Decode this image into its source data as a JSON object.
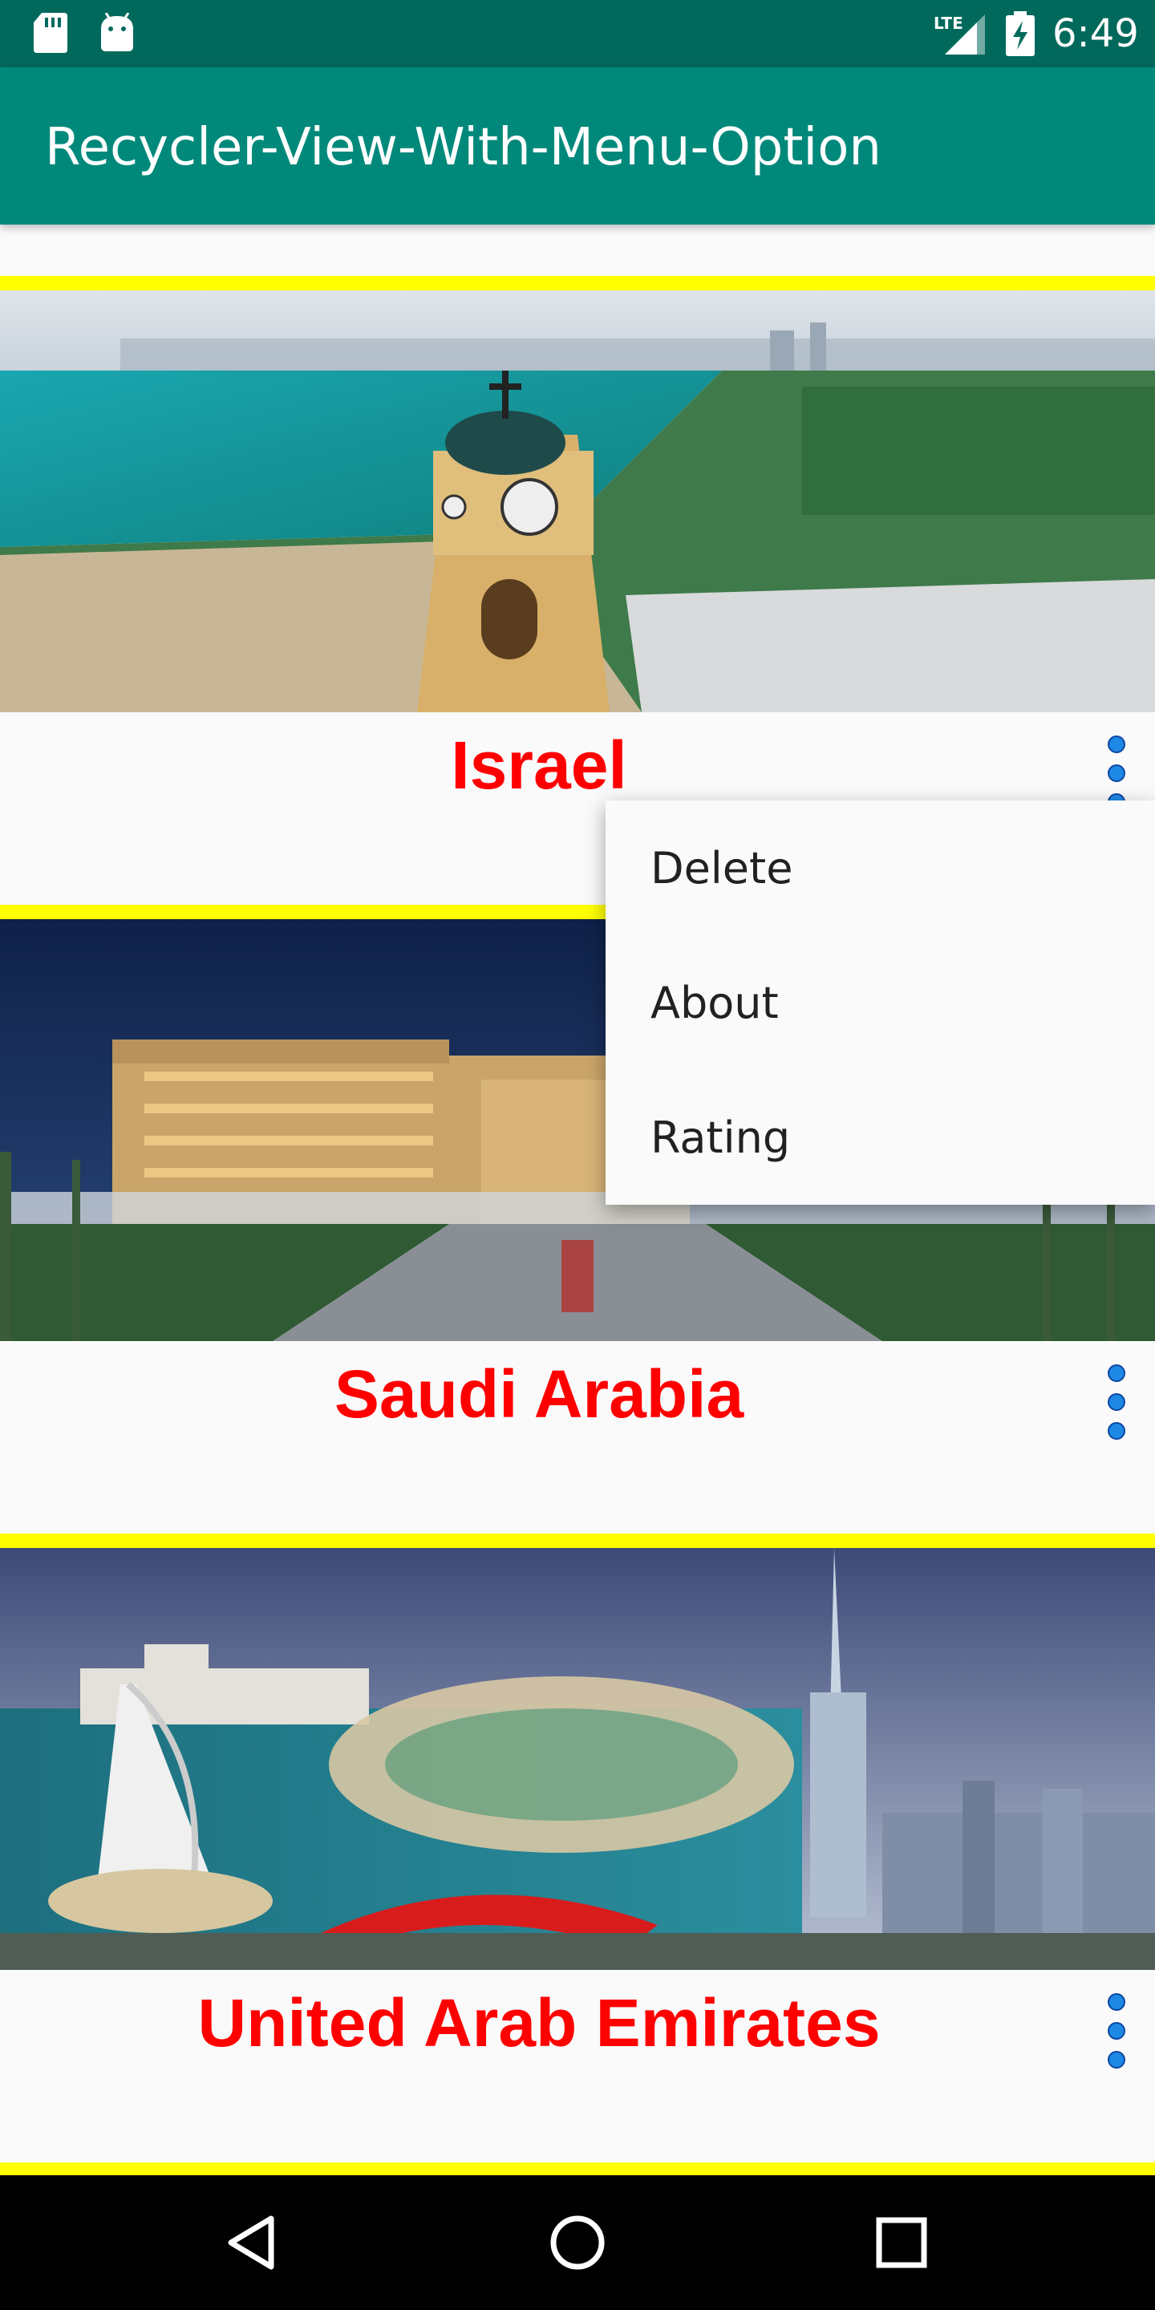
{
  "status_bar": {
    "time": "6:49",
    "network_label": "LTE",
    "icons": [
      "sd-card-icon",
      "android-icon",
      "lte-signal-icon",
      "battery-charging-icon"
    ]
  },
  "app_bar": {
    "title": "Recycler-View-With-Menu-Option",
    "color": "#00897b"
  },
  "cards": [
    {
      "name": "Israel",
      "image": "aerial-coast-clock-tower-image"
    },
    {
      "name": "Saudi Arabia",
      "image": "palace-night-boulevard-image"
    },
    {
      "name": "United Arab Emirates",
      "image": "dubai-skyline-collage-image"
    }
  ],
  "popup_menu": {
    "items": [
      {
        "label": "Delete"
      },
      {
        "label": "About"
      },
      {
        "label": "Rating"
      }
    ]
  },
  "nav_bar": {
    "buttons": [
      "back-icon",
      "home-icon",
      "recents-icon"
    ]
  },
  "colors": {
    "status_bar": "#00695c",
    "card_border": "#ffff00",
    "card_title": "#ff0000",
    "overflow_dots": "#1e88e5"
  }
}
